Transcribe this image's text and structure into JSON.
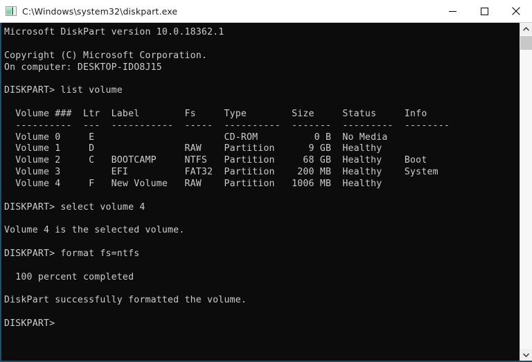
{
  "window": {
    "title": "C:\\Windows\\system32\\diskpart.exe",
    "icon": "console-icon",
    "controls": {
      "minimize": "Minimize",
      "maximize": "Maximize",
      "close": "Close"
    }
  },
  "colors": {
    "console_background": "#0c0c0c",
    "console_text": "#cccccc",
    "titlebar_background": "#ffffff",
    "titlebar_text": "#1b1b1b",
    "window_border": "#1c4f6b",
    "scrollbar_track": "#f7f7f7",
    "scrollbar_thumb": "#c8c8c8"
  },
  "console": {
    "prompt": "DISKPART>",
    "banner": {
      "version_line": "Microsoft DiskPart version 10.0.18362.1",
      "copyright_line": "Copyright (C) Microsoft Corporation.",
      "computer_line": "On computer: DESKTOP-IDO8J15",
      "computer_name": "DESKTOP-IDO8J15",
      "version": "10.0.18362.1"
    },
    "commands": {
      "list_volume": "list volume",
      "select_volume": "select volume 4",
      "format": "format fs=ntfs"
    },
    "messages": {
      "selected": "Volume 4 is the selected volume.",
      "progress": "100 percent completed",
      "formatted": "DiskPart successfully formatted the volume."
    },
    "volume_table": {
      "headers": [
        "Volume ###",
        "Ltr",
        "Label",
        "Fs",
        "Type",
        "Size",
        "Status",
        "Info"
      ],
      "separators": [
        "----------",
        "---",
        "-----------",
        "-----",
        "----------",
        "-------",
        "---------",
        "--------"
      ],
      "rows": [
        {
          "volume": "Volume 0",
          "ltr": "E",
          "label": "",
          "fs": "",
          "type": "CD-ROM",
          "size": "0 B",
          "status": "No Media",
          "info": ""
        },
        {
          "volume": "Volume 1",
          "ltr": "D",
          "label": "",
          "fs": "RAW",
          "type": "Partition",
          "size": "9 GB",
          "status": "Healthy",
          "info": ""
        },
        {
          "volume": "Volume 2",
          "ltr": "C",
          "label": "BOOTCAMP",
          "fs": "NTFS",
          "type": "Partition",
          "size": "68 GB",
          "status": "Healthy",
          "info": "Boot"
        },
        {
          "volume": "Volume 3",
          "ltr": "",
          "label": "EFI",
          "fs": "FAT32",
          "type": "Partition",
          "size": "200 MB",
          "status": "Healthy",
          "info": "System"
        },
        {
          "volume": "Volume 4",
          "ltr": "F",
          "label": "New Volume",
          "fs": "RAW",
          "type": "Partition",
          "size": "1006 MB",
          "status": "Healthy",
          "info": ""
        }
      ]
    },
    "text": "Microsoft DiskPart version 10.0.18362.1\n\nCopyright (C) Microsoft Corporation.\nOn computer: DESKTOP-IDO8J15\n\nDISKPART> list volume\n\n  Volume ###  Ltr  Label        Fs     Type        Size     Status     Info\n  ----------  ---  -----------  -----  ----------  -------  ---------  --------\n  Volume 0     E                       CD-ROM          0 B  No Media\n  Volume 1     D                RAW    Partition      9 GB  Healthy\n  Volume 2     C   BOOTCAMP     NTFS   Partition     68 GB  Healthy    Boot\n  Volume 3         EFI          FAT32  Partition    200 MB  Healthy    System\n  Volume 4     F   New Volume   RAW    Partition   1006 MB  Healthy\n\nDISKPART> select volume 4\n\nVolume 4 is the selected volume.\n\nDISKPART> format fs=ntfs\n\n  100 percent completed\n\nDiskPart successfully formatted the volume.\n\nDISKPART>"
  },
  "scrollbar": {
    "up_arrow": "chevron-up-icon",
    "down_arrow": "chevron-down-icon"
  }
}
